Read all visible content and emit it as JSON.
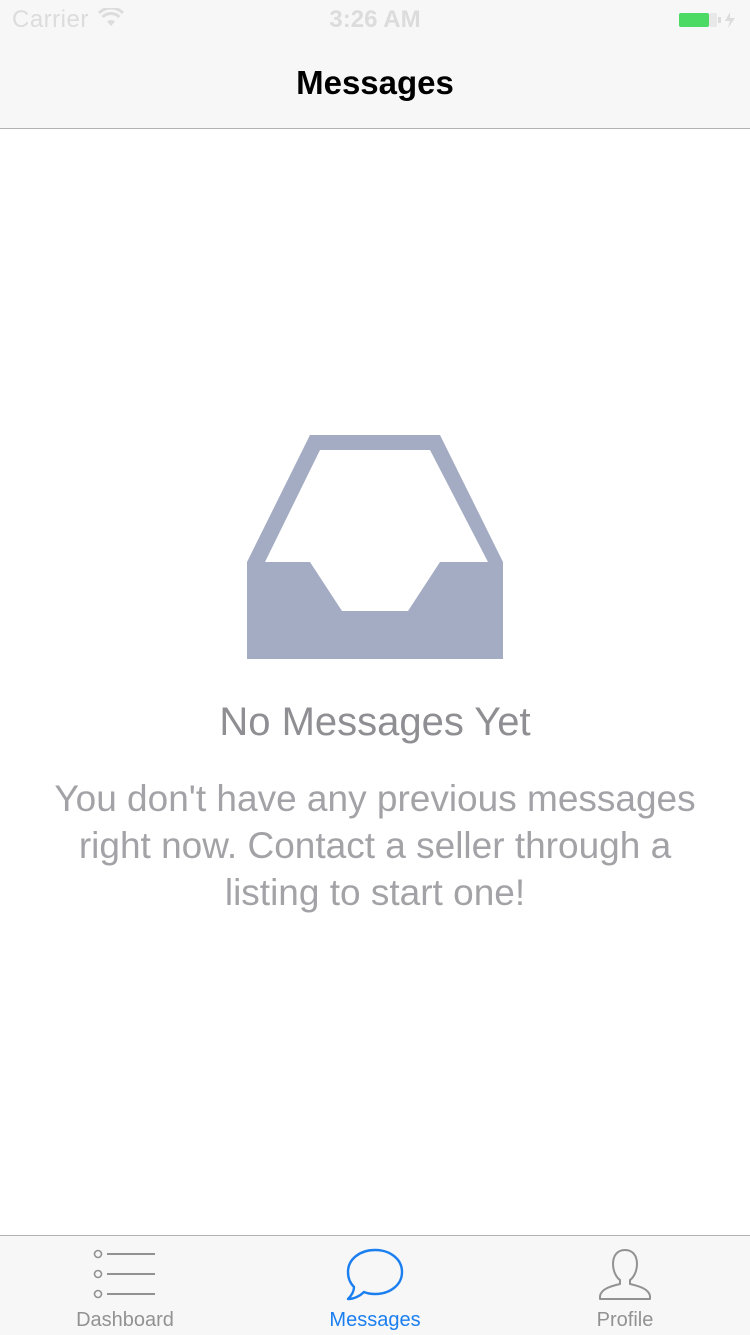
{
  "status_bar": {
    "carrier": "Carrier",
    "time": "3:26 AM",
    "wifi_icon": "wifi-icon",
    "battery_icon": "battery-icon",
    "battery_color": "#4cd964"
  },
  "nav": {
    "title": "Messages"
  },
  "empty_state": {
    "icon": "inbox-icon",
    "icon_color": "#a4acc3",
    "title": "No Messages Yet",
    "description": "You don't have any previous messages right now. Contact a seller through a listing to start one!"
  },
  "tab_bar": {
    "active_color": "#1b7ff0",
    "inactive_color": "#929292",
    "tabs": [
      {
        "label": "Dashboard",
        "icon": "list-icon",
        "active": false
      },
      {
        "label": "Messages",
        "icon": "chat-bubble-icon",
        "active": true
      },
      {
        "label": "Profile",
        "icon": "person-icon",
        "active": false
      }
    ]
  }
}
